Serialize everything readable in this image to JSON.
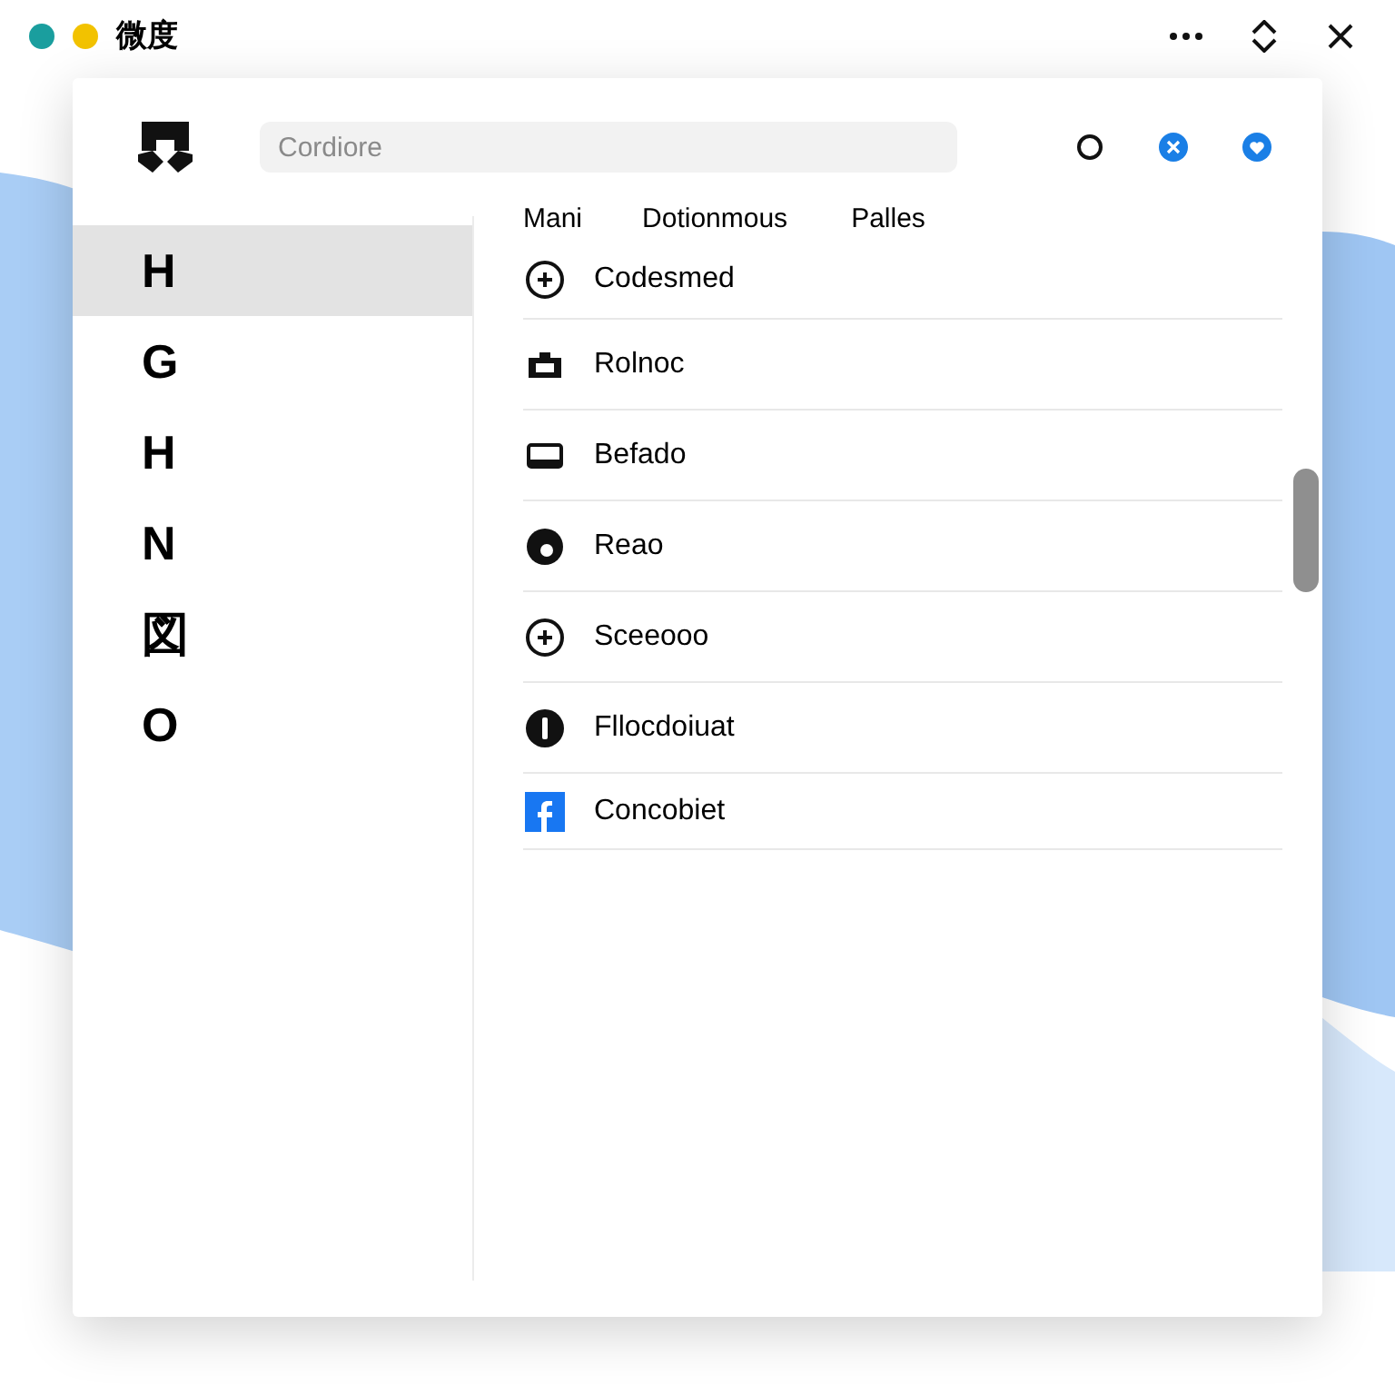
{
  "window": {
    "title": "微度",
    "dots": [
      {
        "color": "#1a9e9e"
      },
      {
        "color": "#f2c200"
      }
    ]
  },
  "search": {
    "placeholder": "Cordiore"
  },
  "tabs": [
    {
      "label": "Mani"
    },
    {
      "label": "Dotionmous"
    },
    {
      "label": "Palles"
    }
  ],
  "sidebar": {
    "items": [
      {
        "label": "H",
        "selected": true
      },
      {
        "label": "G",
        "selected": false
      },
      {
        "label": "H",
        "selected": false
      },
      {
        "label": "N",
        "selected": false
      },
      {
        "label": "図",
        "selected": false
      },
      {
        "label": "O",
        "selected": false
      }
    ]
  },
  "list": [
    {
      "kind": "plus-circle",
      "label": "Codesmed"
    },
    {
      "kind": "bag",
      "label": "Rolnoc"
    },
    {
      "kind": "rectangle",
      "label": "Befado"
    },
    {
      "kind": "disc",
      "label": "Reao"
    },
    {
      "kind": "plus-circle",
      "label": "Sceeooo"
    },
    {
      "kind": "bar-disc",
      "label": "Fllocdoiuat"
    },
    {
      "kind": "blue-square",
      "label": "Concobiet"
    }
  ]
}
